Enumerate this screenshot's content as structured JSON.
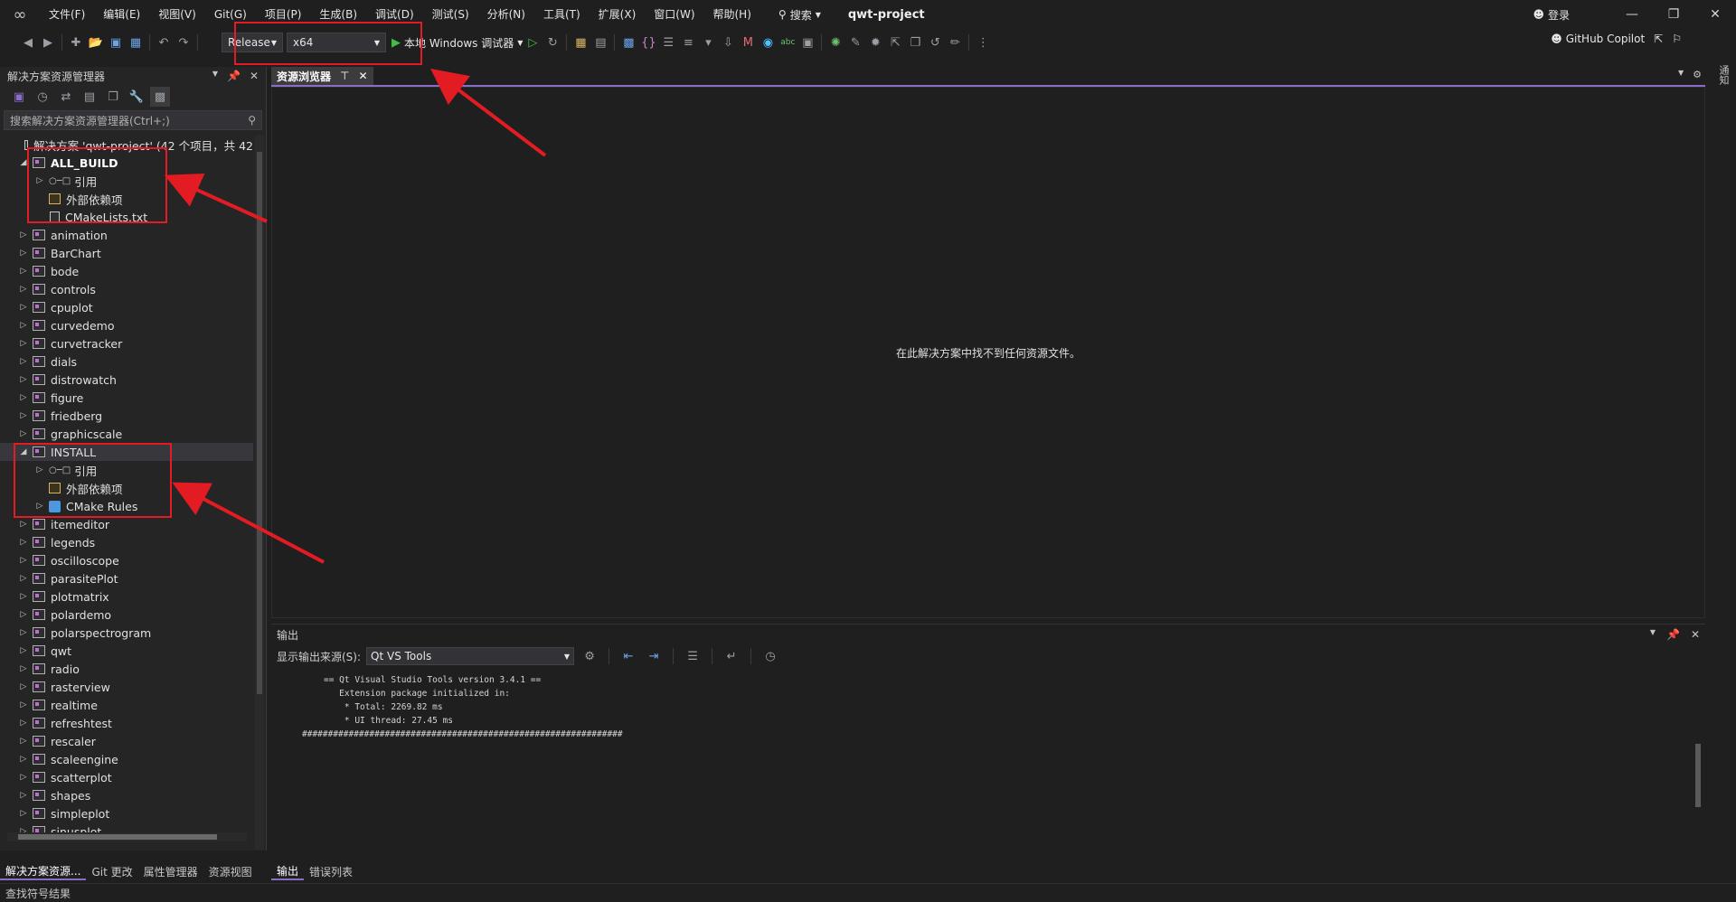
{
  "menu": {
    "items": [
      "文件(F)",
      "编辑(E)",
      "视图(V)",
      "Git(G)",
      "项目(P)",
      "生成(B)",
      "调试(D)",
      "测试(S)",
      "分析(N)",
      "工具(T)",
      "扩展(X)",
      "窗口(W)",
      "帮助(H)"
    ],
    "search_label": "搜索",
    "project_name": "qwt-project",
    "login_label": "登录"
  },
  "toolbar": {
    "config_value": "Release",
    "platform_value": "x64",
    "debugger_label": "本地 Windows 调试器",
    "copilot_label": "GitHub Copilot"
  },
  "solution_explorer": {
    "title": "解决方案资源管理器",
    "search_placeholder": "搜索解决方案资源管理器(Ctrl+;)",
    "solution_label": "解决方案 'qwt-project' (42 个项目，共 42",
    "tree": [
      {
        "label": "ALL_BUILD",
        "type": "project",
        "expanded": true,
        "bold": true
      },
      {
        "label": "引用",
        "type": "ref",
        "level": 1,
        "expandable": true
      },
      {
        "label": "外部依赖项",
        "type": "dep",
        "level": 1
      },
      {
        "label": "CMakeLists.txt",
        "type": "file",
        "level": 1
      },
      {
        "label": "animation",
        "type": "project"
      },
      {
        "label": "BarChart",
        "type": "project"
      },
      {
        "label": "bode",
        "type": "project"
      },
      {
        "label": "controls",
        "type": "project"
      },
      {
        "label": "cpuplot",
        "type": "project"
      },
      {
        "label": "curvedemo",
        "type": "project"
      },
      {
        "label": "curvetracker",
        "type": "project"
      },
      {
        "label": "dials",
        "type": "project"
      },
      {
        "label": "distrowatch",
        "type": "project"
      },
      {
        "label": "figure",
        "type": "project"
      },
      {
        "label": "friedberg",
        "type": "project"
      },
      {
        "label": "graphicscale",
        "type": "project"
      },
      {
        "label": "INSTALL",
        "type": "project",
        "expanded": true,
        "selected": true
      },
      {
        "label": "引用",
        "type": "ref",
        "level": 1,
        "expandable": true
      },
      {
        "label": "外部依赖项",
        "type": "dep",
        "level": 1
      },
      {
        "label": "CMake Rules",
        "type": "rules",
        "level": 1,
        "expandable": true
      },
      {
        "label": "itemeditor",
        "type": "project"
      },
      {
        "label": "legends",
        "type": "project"
      },
      {
        "label": "oscilloscope",
        "type": "project"
      },
      {
        "label": "parasitePlot",
        "type": "project"
      },
      {
        "label": "plotmatrix",
        "type": "project"
      },
      {
        "label": "polardemo",
        "type": "project"
      },
      {
        "label": "polarspectrogram",
        "type": "project"
      },
      {
        "label": "qwt",
        "type": "project"
      },
      {
        "label": "radio",
        "type": "project"
      },
      {
        "label": "rasterview",
        "type": "project"
      },
      {
        "label": "realtime",
        "type": "project"
      },
      {
        "label": "refreshtest",
        "type": "project"
      },
      {
        "label": "rescaler",
        "type": "project"
      },
      {
        "label": "scaleengine",
        "type": "project"
      },
      {
        "label": "scatterplot",
        "type": "project"
      },
      {
        "label": "shapes",
        "type": "project"
      },
      {
        "label": "simpleplot",
        "type": "project"
      },
      {
        "label": "sinusplot",
        "type": "project"
      }
    ],
    "bottom_tabs": [
      "解决方案资源...",
      "Git 更改",
      "属性管理器",
      "资源视图"
    ]
  },
  "resource_view": {
    "tab_label": "资源浏览器",
    "empty_message": "在此解决方案中找不到任何资源文件。"
  },
  "right_strip_label": "通知",
  "output": {
    "title": "输出",
    "source_label": "显示输出来源(S):",
    "source_value": "Qt VS Tools",
    "lines": [
      "== Qt Visual Studio Tools version 3.4.1 ==",
      "   Extension package initialized in:",
      "    * Total: 2269.82 ms",
      "    * UI thread: 27.45 ms",
      "##############################################################"
    ],
    "tabs": [
      "输出",
      "错误列表"
    ]
  },
  "status": {
    "text": "查找符号结果"
  }
}
